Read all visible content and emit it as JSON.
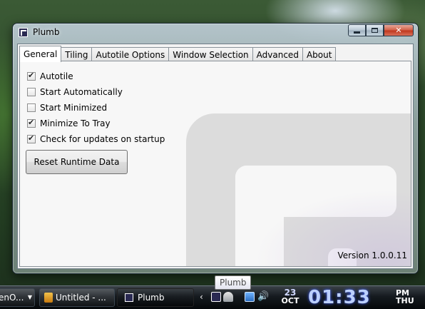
{
  "window": {
    "title": "Plumb",
    "controls": {
      "minimize": "",
      "maximize": "",
      "close": "✕"
    }
  },
  "tabs": [
    {
      "label": "General",
      "active": true
    },
    {
      "label": "Tiling",
      "active": false
    },
    {
      "label": "Autotile Options",
      "active": false
    },
    {
      "label": "Window Selection",
      "active": false
    },
    {
      "label": "Advanced",
      "active": false
    },
    {
      "label": "About",
      "active": false
    }
  ],
  "general": {
    "options": [
      {
        "label": "Autotile",
        "checked": true
      },
      {
        "label": "Start Automatically",
        "checked": false
      },
      {
        "label": "Start Minimized",
        "checked": false
      },
      {
        "label": "Minimize To Tray",
        "checked": true
      },
      {
        "label": "Check for updates on startup",
        "checked": true
      }
    ],
    "reset_button": "Reset Runtime Data",
    "version": "Version 1.0.0.11"
  },
  "tooltip": "Plumb",
  "taskbar": {
    "lang_button": "enO...",
    "untitled_button": "Untitled - ...",
    "plumb_button": "Plumb",
    "tray_chevron": "‹",
    "volume_glyph": "🔊"
  },
  "clock": {
    "day": "23",
    "month": "OCT",
    "time": "01:33",
    "ampm": "PM",
    "weekday": "THU"
  }
}
